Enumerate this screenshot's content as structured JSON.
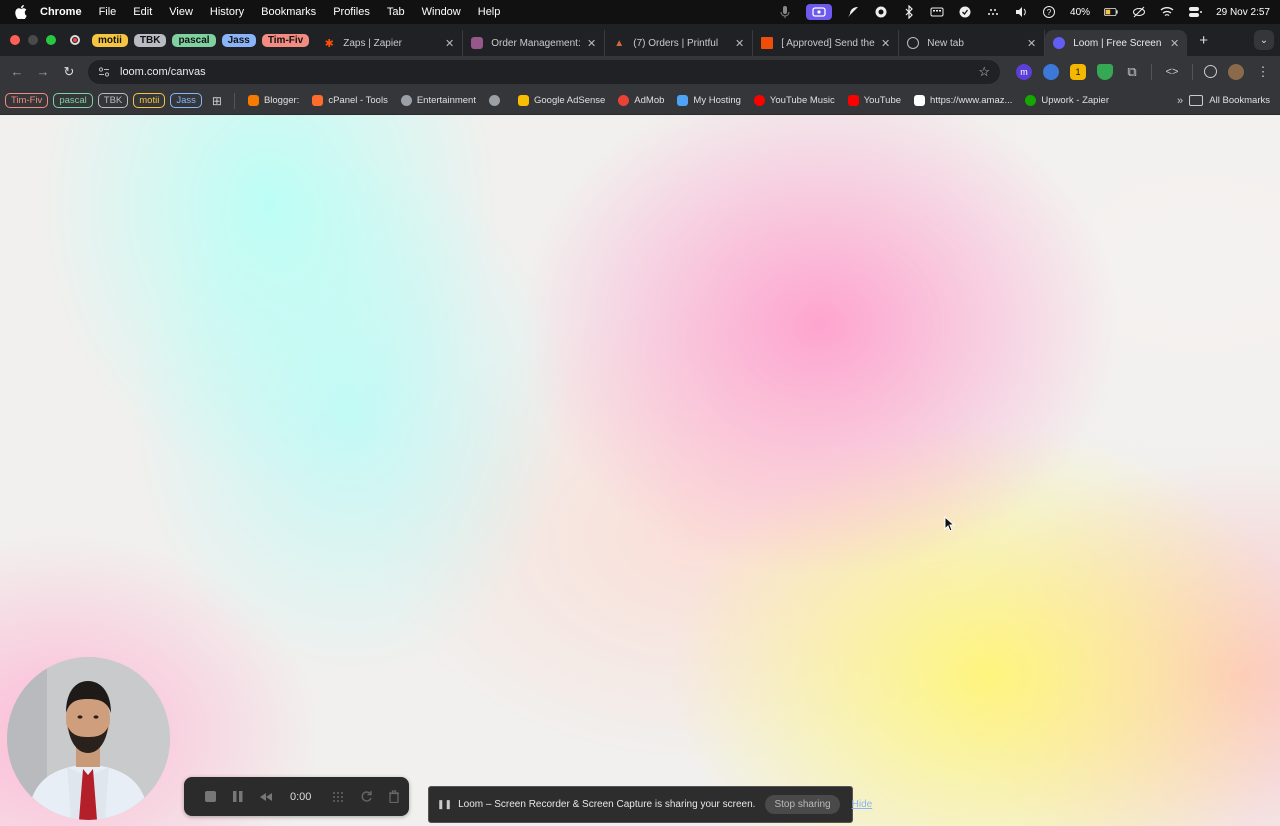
{
  "menubar": {
    "app_name": "Chrome",
    "items": [
      "File",
      "Edit",
      "View",
      "History",
      "Bookmarks",
      "Profiles",
      "Tab",
      "Window",
      "Help"
    ],
    "battery": "40%",
    "clock": "29 Nov  2:57"
  },
  "tabs": {
    "groups": [
      {
        "label": "motii",
        "color": "#f5c542"
      },
      {
        "label": "TBK",
        "color": "#b8bcc2"
      },
      {
        "label": "pascal",
        "color": "#7fd1a0"
      },
      {
        "label": "Jass",
        "color": "#8ab4f8"
      },
      {
        "label": "Tim-Fiv",
        "color": "#f28b82"
      }
    ],
    "items": [
      {
        "title": "Zaps | Zapier",
        "icon": "zapier-icon",
        "color": "#ff4f00"
      },
      {
        "title": "Order Management: O",
        "icon": "shop-icon",
        "color": "#96588a"
      },
      {
        "title": "(7) Orders | Printful",
        "icon": "printful-icon",
        "color": "#d06b3a"
      },
      {
        "title": "[ Approved] Send the",
        "icon": "doc-icon",
        "color": "#ee4d0a"
      },
      {
        "title": "New tab",
        "icon": "chrome-icon",
        "color": "#9aa0a6"
      },
      {
        "title": "Loom | Free Screen &",
        "icon": "loom-icon",
        "color": "#625df5",
        "active": true
      }
    ]
  },
  "toolbar": {
    "url": "loom.com/canvas"
  },
  "bookmarks": {
    "chips": [
      {
        "label": "Tim-Fiv",
        "color": "#f28b82"
      },
      {
        "label": "pascal",
        "color": "#7fd1a0"
      },
      {
        "label": "TBK",
        "color": "#b8bcc2"
      },
      {
        "label": "motii",
        "color": "#f5c542"
      },
      {
        "label": "Jass",
        "color": "#8ab4f8"
      }
    ],
    "items": [
      {
        "label": "Blogger:",
        "color": "#f57c00"
      },
      {
        "label": "cPanel - Tools",
        "color": "#ff6c2c"
      },
      {
        "label": "Entertainment",
        "color": "#9aa0a6"
      },
      {
        "label": "",
        "color": "#9aa0a6"
      },
      {
        "label": "Google AdSense",
        "color": "#fbbc04"
      },
      {
        "label": "AdMob",
        "color": "#ea4335"
      },
      {
        "label": "My Hosting",
        "color": "#4fa3f7"
      },
      {
        "label": "YouTube Music",
        "color": "#ff0000"
      },
      {
        "label": "YouTube",
        "color": "#ff0000"
      },
      {
        "label": "https://www.amaz...",
        "color": "#ffffff"
      },
      {
        "label": "Upwork - Zapier",
        "color": "#14a800"
      }
    ],
    "all_label": "All Bookmarks"
  },
  "loom": {
    "timer": "0:00",
    "share_text": "Loom – Screen Recorder & Screen Capture is sharing your screen.",
    "stop_label": "Stop sharing",
    "hide_label": "Hide"
  }
}
